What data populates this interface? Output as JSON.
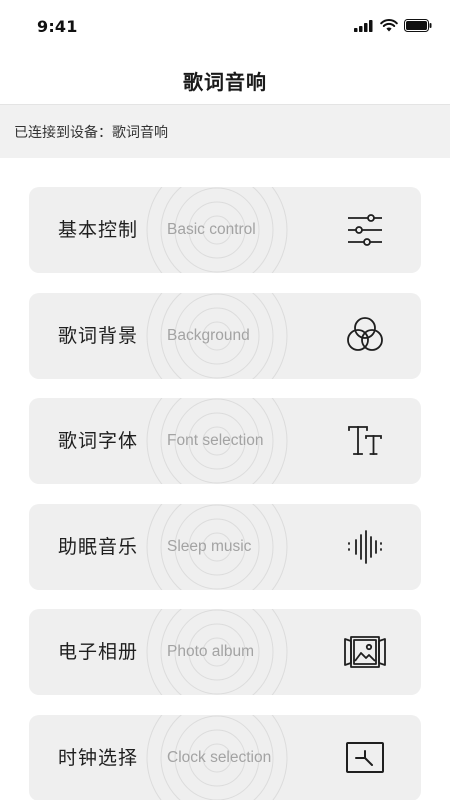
{
  "status_bar": {
    "time": "9:41"
  },
  "header": {
    "title": "歌词音响"
  },
  "connection": {
    "text": "已连接到设备：歌词音响"
  },
  "menu": {
    "items": [
      {
        "title": "基本控制",
        "subtitle": "Basic control",
        "icon": "sliders-icon"
      },
      {
        "title": "歌词背景",
        "subtitle": "Background",
        "icon": "color-circles-icon"
      },
      {
        "title": "歌词字体",
        "subtitle": "Font selection",
        "icon": "text-size-icon"
      },
      {
        "title": "助眠音乐",
        "subtitle": "Sleep music",
        "icon": "sound-wave-icon"
      },
      {
        "title": "电子相册",
        "subtitle": "Photo album",
        "icon": "photo-album-icon"
      },
      {
        "title": "时钟选择",
        "subtitle": "Clock selection",
        "icon": "clock-icon"
      }
    ]
  }
}
